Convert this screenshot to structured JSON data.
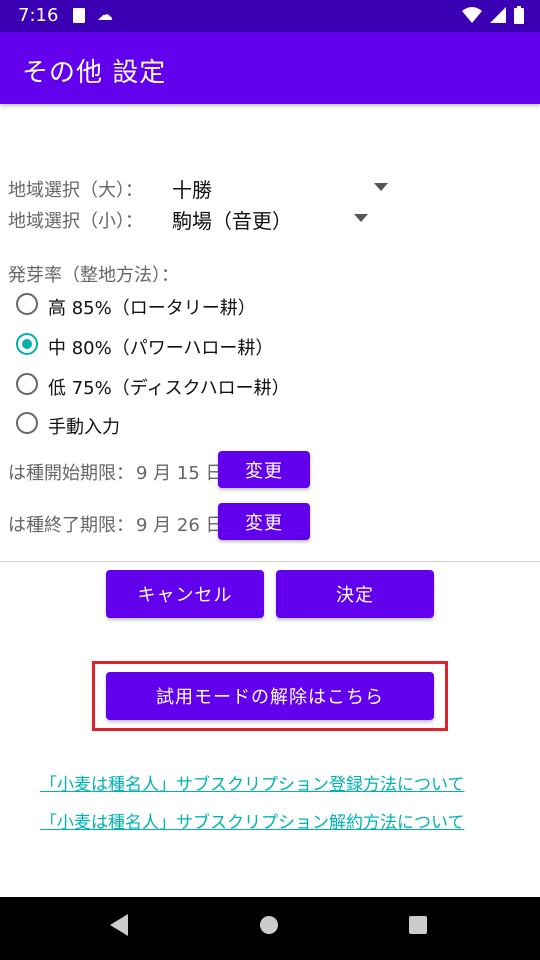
{
  "status_bar": {
    "time": "7:16"
  },
  "app_bar": {
    "title": "その他 設定"
  },
  "region": {
    "large_label": "地域選択（大）：",
    "large_value": "十勝",
    "small_label": "地域選択（小）：",
    "small_value": "駒場（音更）"
  },
  "germination": {
    "label": "発芽率（整地方法）：",
    "options": [
      {
        "label": "高 85%（ロータリー耕）",
        "checked": false
      },
      {
        "label": "中 80%（パワーハロー耕）",
        "checked": true
      },
      {
        "label": "低 75%（ディスクハロー耕）",
        "checked": false
      },
      {
        "label": "手動入力",
        "checked": false
      }
    ]
  },
  "sowing": {
    "start_label": "は種開始期限：",
    "start_date": "9 月 15 日",
    "end_label": "は種終了期限：",
    "end_date": "9 月 26 日",
    "change_label": "変更"
  },
  "actions": {
    "cancel": "キャンセル",
    "ok": "決定"
  },
  "trial": {
    "button": "試用モードの解除はこちら"
  },
  "links": {
    "register": "「小麦は種名人」サブスクリプション登録方法について",
    "cancel": "「小麦は種名人」サブスクリプション解約方法について"
  },
  "colors": {
    "primary": "#6200ee",
    "status_bar": "#3b00b4",
    "accent": "#00b3a6",
    "highlight": "#e0202a"
  }
}
